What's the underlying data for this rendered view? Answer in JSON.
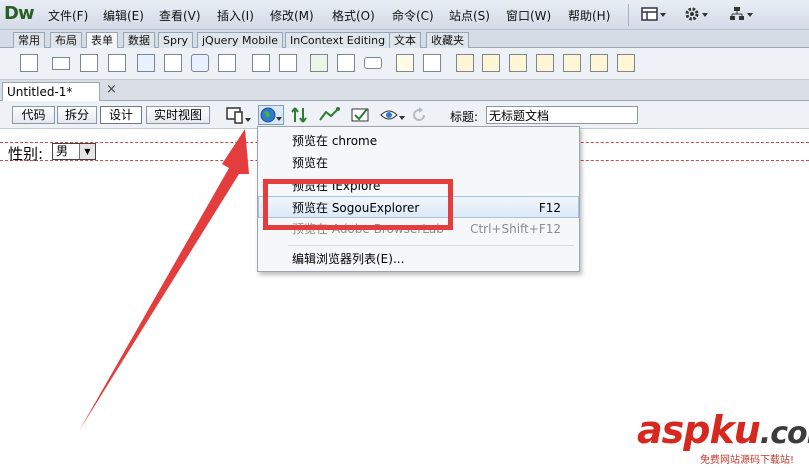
{
  "app": {
    "logo": "Dw"
  },
  "menu": [
    "文件(F)",
    "编辑(E)",
    "查看(V)",
    "插入(I)",
    "修改(M)",
    "格式(O)",
    "命令(C)",
    "站点(S)",
    "窗口(W)",
    "帮助(H)"
  ],
  "insert_tabs": [
    "常用",
    "布局",
    "表单",
    "数据",
    "Spry",
    "jQuery Mobile",
    "InContext Editing",
    "文本",
    "收藏夹"
  ],
  "active_insert_tab": "表单",
  "document": {
    "tab_title": "Untitled-1*",
    "close_glyph": "×"
  },
  "view_buttons": [
    "代码",
    "拆分",
    "设计",
    "实时视图"
  ],
  "active_view": "设计",
  "title_field": {
    "label": "标题:",
    "value": "无标题文档"
  },
  "form": {
    "label": "性别:",
    "select_value": "男"
  },
  "preview_menu": [
    {
      "label": "预览在 chrome",
      "shortcut": "",
      "state": "normal"
    },
    {
      "label": "预览在",
      "shortcut": "",
      "state": "normal"
    },
    {
      "label": "预览在 IExplore",
      "shortcut": "",
      "state": "partially-covered"
    },
    {
      "label": "预览在 SogouExplorer",
      "shortcut": "F12",
      "state": "hover"
    },
    {
      "label": "预览在 Adobe BrowserLab",
      "shortcut": "Ctrl+Shift+F12",
      "state": "disabled"
    },
    {
      "label": "编辑浏览器列表(E)...",
      "shortcut": "",
      "state": "normal"
    }
  ],
  "watermark": {
    "text": "aspku",
    "suffix": ".com",
    "subtitle": "免费网站源码下载站!"
  },
  "colors": {
    "annotation_red": "#e33d3d",
    "watermark_red": "#d6281f",
    "watermark_dark": "#3c3c3c",
    "watermark_green": "#2ea043"
  }
}
